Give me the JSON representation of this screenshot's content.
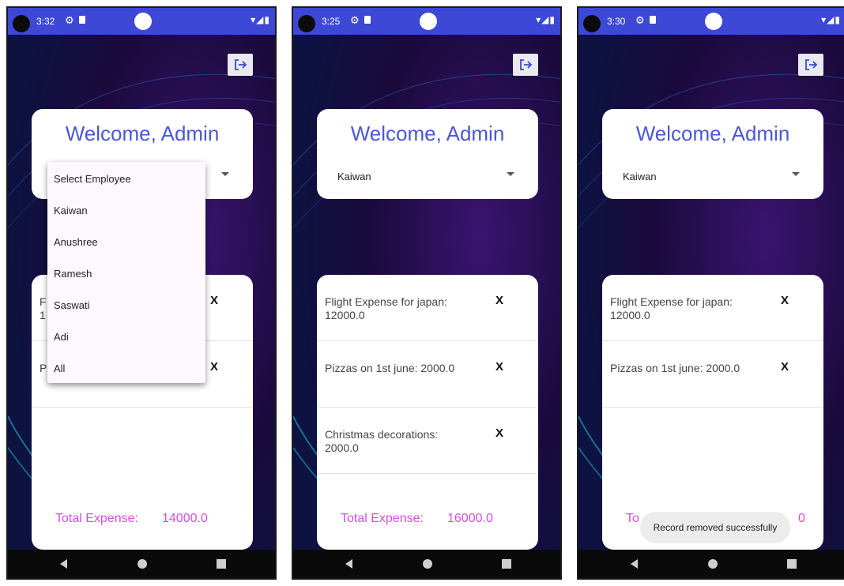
{
  "screens": [
    {
      "time": "3:32",
      "welcome": "Welcome, Admin",
      "selected_employee": "",
      "items": [
        {
          "text": "F\n1"
        },
        {
          "text": "P"
        }
      ],
      "total_label": "Total Expense:",
      "total_value": "14000.0",
      "dropdown": [
        "Select Employee",
        "Kaiwan",
        "Anushree",
        "Ramesh",
        "Saswati",
        "Adi",
        "All"
      ]
    },
    {
      "time": "3:25",
      "welcome": "Welcome, Admin",
      "selected_employee": "Kaiwan",
      "items": [
        {
          "text": "Flight Expense for japan: 12000.0"
        },
        {
          "text": "Pizzas on 1st june: 2000.0"
        },
        {
          "text": "Christmas decorations: 2000.0"
        }
      ],
      "total_label": "Total Expense:",
      "total_value": "16000.0"
    },
    {
      "time": "3:30",
      "welcome": "Welcome, Admin",
      "selected_employee": "Kaiwan",
      "items": [
        {
          "text": "Flight Expense for japan: 12000.0"
        },
        {
          "text": "Pizzas on 1st june: 2000.0"
        }
      ],
      "total_label_partial": "To",
      "total_value_partial": "0",
      "toast": "Record removed successfully"
    }
  ],
  "remove_label": "X",
  "colors": {
    "status_bar": "#3d48d6",
    "welcome_text": "#4a57d8",
    "total_text": "#d24fe0",
    "background_dark": "#1b0a3a"
  }
}
